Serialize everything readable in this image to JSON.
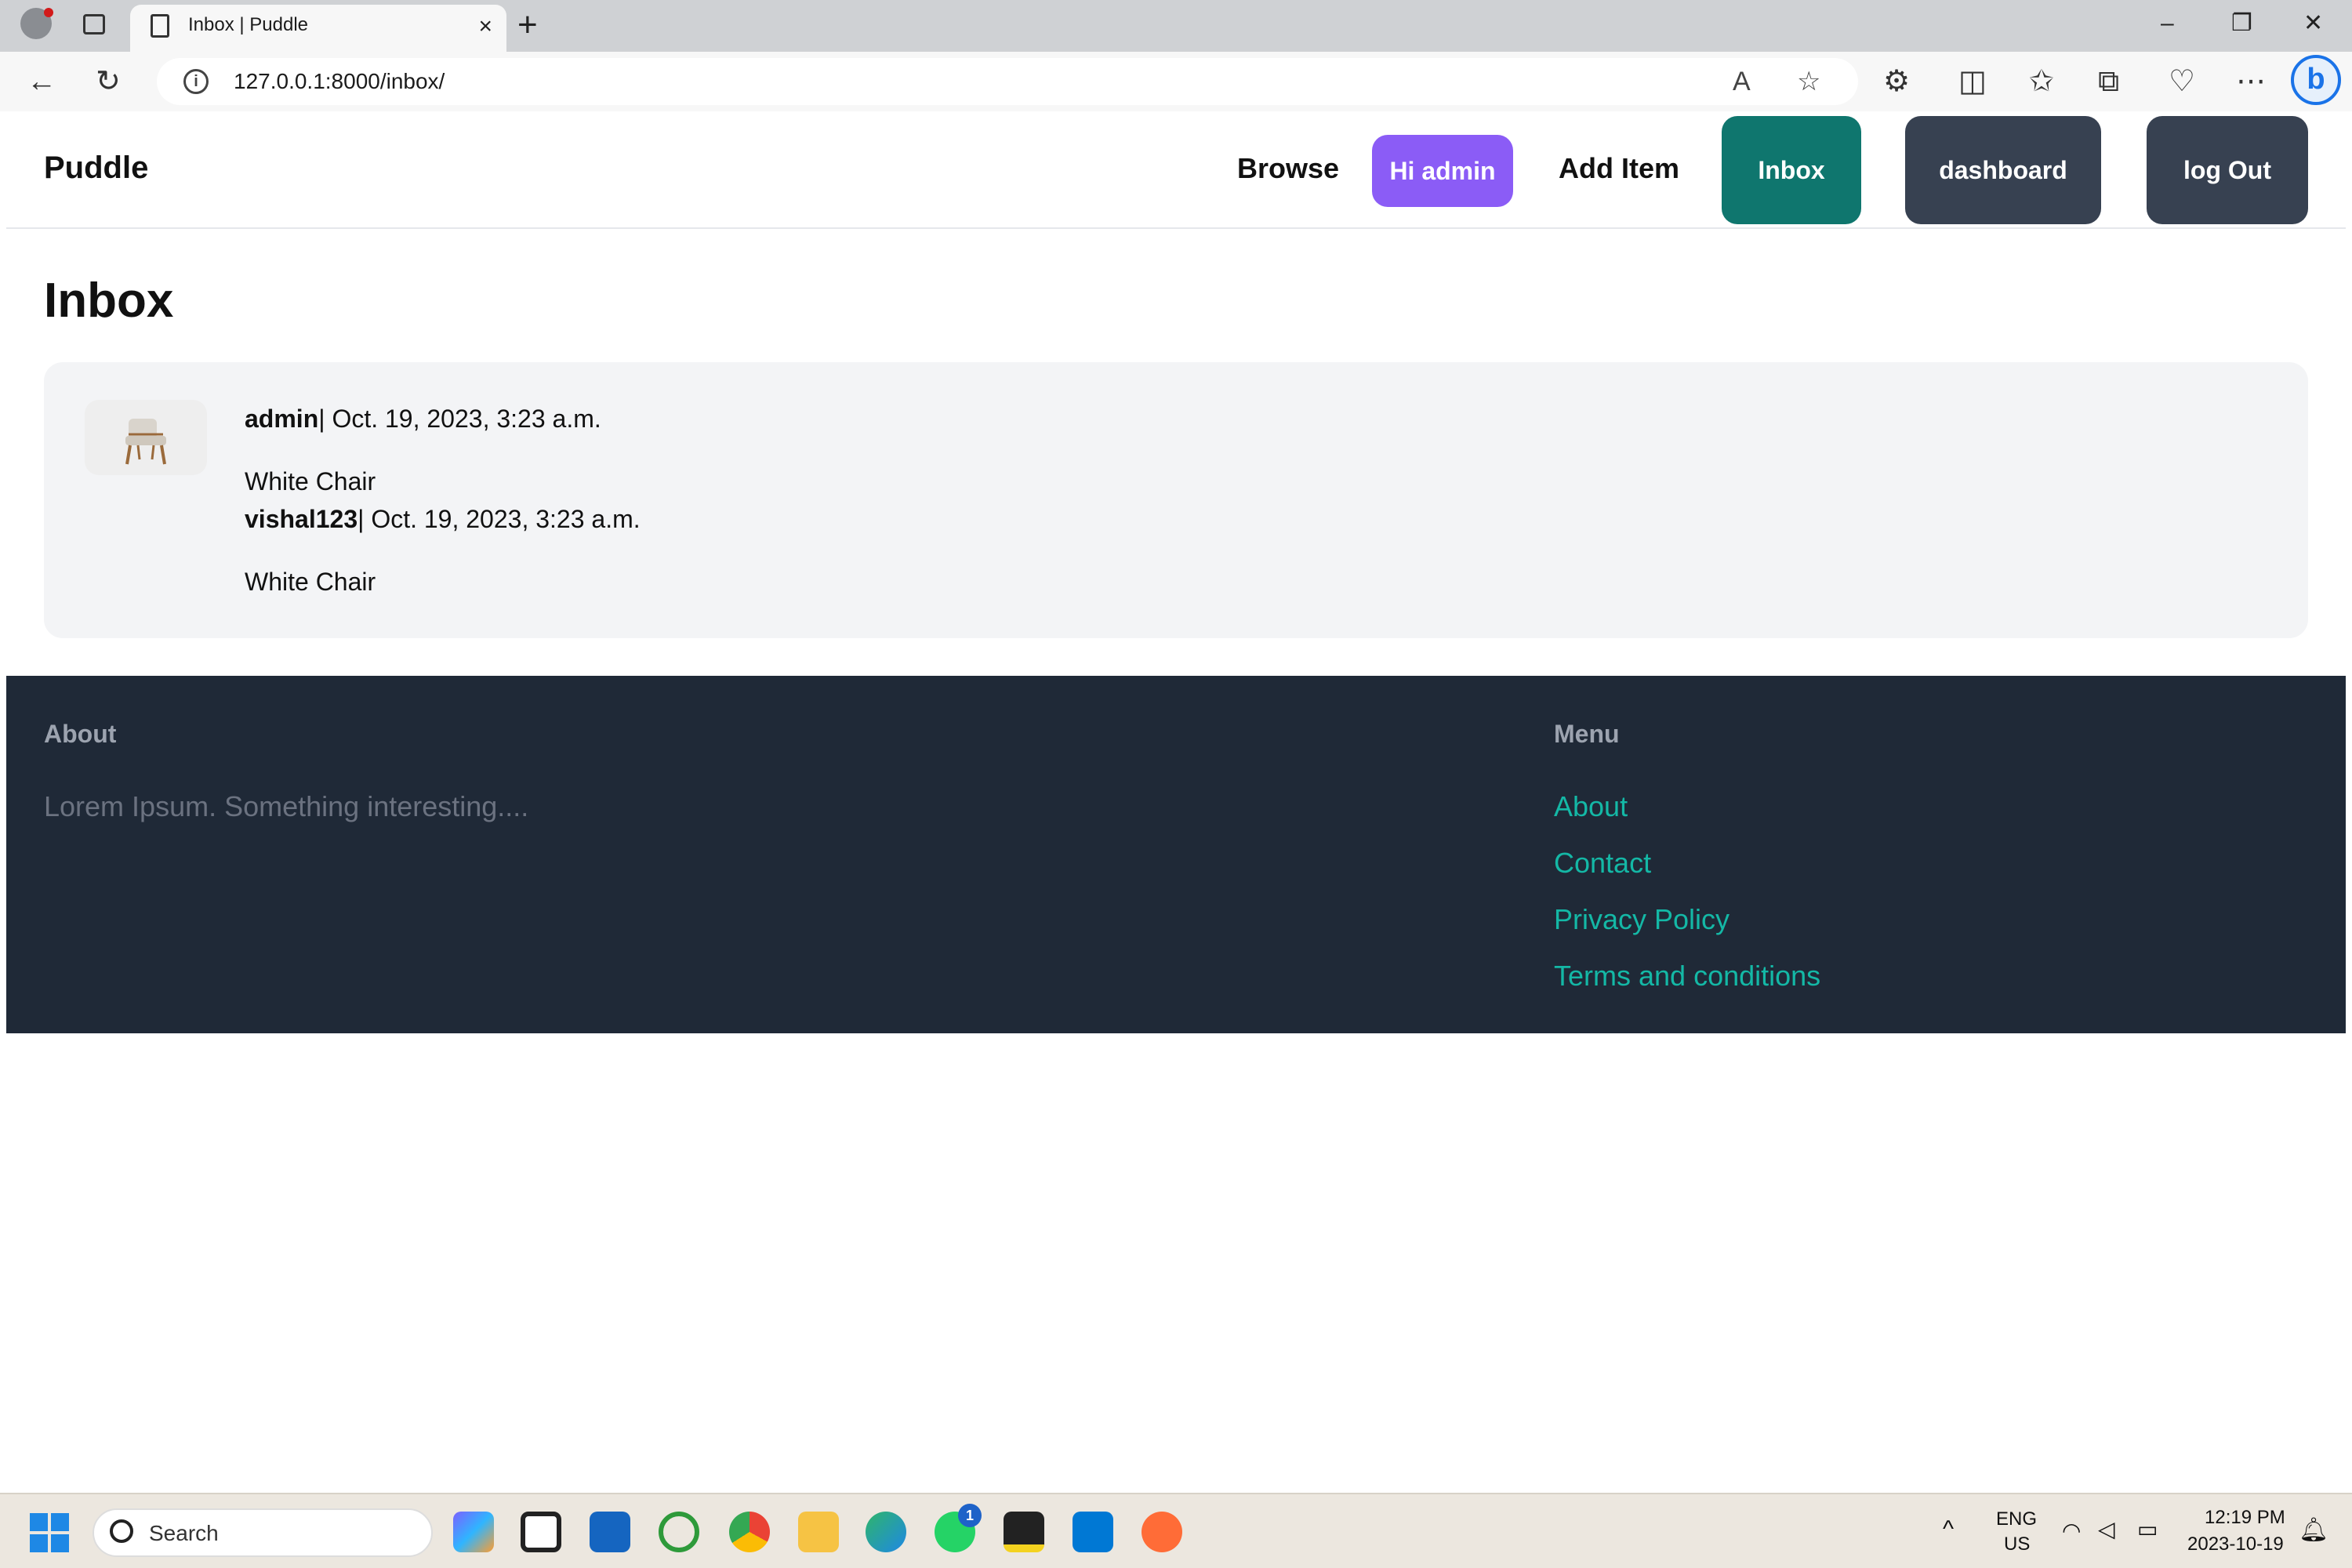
{
  "browser": {
    "tab_title": "Inbox | Puddle",
    "tab_close": "×",
    "new_tab": "+",
    "url": "127.0.0.1:8000/inbox/",
    "window_controls": [
      "–",
      "❐",
      "✕"
    ]
  },
  "navbar": {
    "brand": "Puddle",
    "browse": "Browse",
    "greeting": "Hi admin",
    "add_item": "Add Item",
    "inbox": "Inbox",
    "dashboard": "dashboard",
    "logout": "log Out"
  },
  "page": {
    "title": "Inbox"
  },
  "conversation": {
    "messages": [
      {
        "author": "admin",
        "meta": "| Oct. 19, 2023, 3:23 a.m.",
        "item": "White Chair"
      },
      {
        "author": "vishal123",
        "meta": "| Oct. 19, 2023, 3:23 a.m.",
        "item": "White Chair"
      }
    ]
  },
  "footer": {
    "about_heading": "About",
    "about_text": "Lorem Ipsum. Something interesting....",
    "menu_heading": "Menu",
    "links": [
      "About",
      "Contact",
      "Privacy Policy",
      "Terms and conditions"
    ]
  },
  "taskbar": {
    "search_placeholder": "Search",
    "lang_line1": "ENG",
    "lang_line2": "US",
    "time": "12:19 PM",
    "date": "2023-10-19",
    "whatsapp_badge": "1"
  },
  "colors": {
    "greeting_button": "#8b5cf6",
    "inbox_button": "#0f766e",
    "dark_button": "#374151",
    "footer_bg": "#1f2937",
    "footer_link": "#14b8a6"
  }
}
